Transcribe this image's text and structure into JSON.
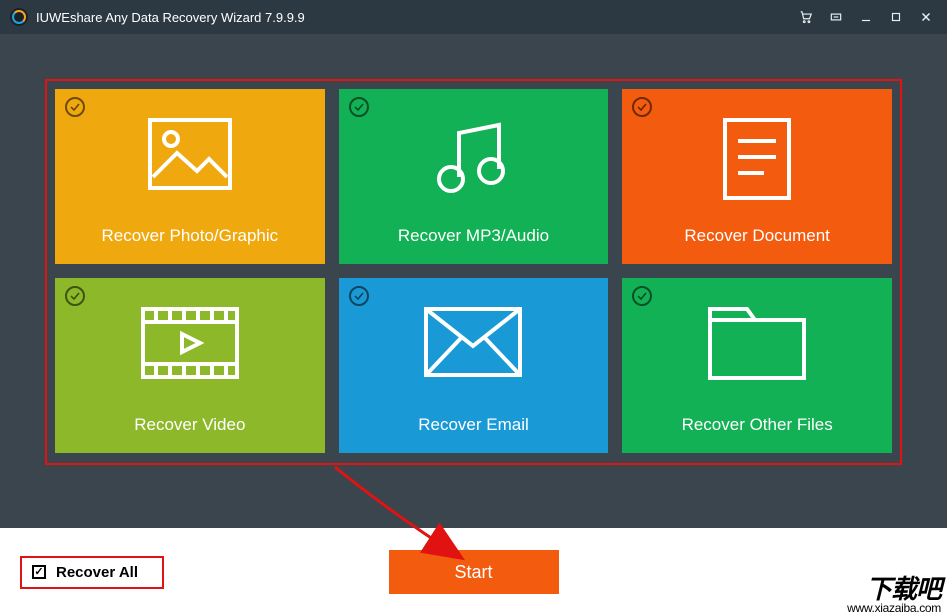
{
  "titlebar": {
    "title": "IUWEshare Any Data Recovery Wizard 7.9.9.9"
  },
  "tiles": {
    "photo": {
      "label": "Recover Photo/Graphic",
      "checked": true,
      "icon": "image-icon",
      "color": "#f0a80f"
    },
    "audio": {
      "label": "Recover MP3/Audio",
      "checked": true,
      "icon": "music-icon",
      "color": "#12b155"
    },
    "document": {
      "label": "Recover Document",
      "checked": true,
      "icon": "document-icon",
      "color": "#f35b0e"
    },
    "video": {
      "label": "Recover Video",
      "checked": true,
      "icon": "film-icon",
      "color": "#8cb82a"
    },
    "email": {
      "label": "Recover Email",
      "checked": true,
      "icon": "mail-icon",
      "color": "#199ad6"
    },
    "other": {
      "label": "Recover Other Files",
      "checked": true,
      "icon": "folder-icon",
      "color": "#12b155"
    }
  },
  "footer": {
    "recover_all_label": "Recover All",
    "recover_all_checked": true,
    "start_label": "Start"
  },
  "watermark": {
    "top": "下载吧",
    "url": "www.xiazaiba.com"
  }
}
